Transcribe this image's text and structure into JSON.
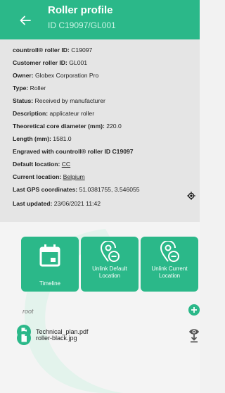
{
  "header": {
    "title": "Roller profile",
    "subtitle": "ID C19097/GL001"
  },
  "details": [
    {
      "label": "countroll® roller ID:",
      "value": "C19097"
    },
    {
      "label": "Customer roller ID:",
      "value": "GL001"
    },
    {
      "label": "Owner:",
      "value": "Globex Corporation Pro"
    },
    {
      "label": "Type:",
      "value": "Roller"
    },
    {
      "label": "Status:",
      "value": "Received by manufacturer"
    },
    {
      "label": "Description:",
      "value": "applicateur roller"
    },
    {
      "label": "Theoretical core diameter (mm):",
      "value": "220.0"
    },
    {
      "label": "Length (mm):",
      "value": "1581.0"
    },
    {
      "label": "Engraved with countroll® roller ID C19097",
      "value": ""
    },
    {
      "label": "Default location:",
      "value": "CC"
    },
    {
      "label": "Current location:",
      "value": "Belgium"
    },
    {
      "label": "Last GPS coordinates:",
      "value": "51.0381755, 3.546055"
    },
    {
      "label": "Last updated:",
      "value": "23/06/2021 11:42"
    }
  ],
  "actions": [
    {
      "label": "Timeline",
      "icon": "calendar-icon"
    },
    {
      "label": "Unlink Default Location",
      "icon": "location-unlink-icon"
    },
    {
      "label": "Unlink Current Location",
      "icon": "location-unlink-icon"
    }
  ],
  "files": {
    "root_label": "root",
    "items": [
      {
        "name": "Technical_plan.pdf",
        "icon": "file-icon",
        "action_icon": "eye-icon"
      },
      {
        "name": "roller-black.jpg",
        "icon": "file-icon",
        "action_icon": "download-icon"
      }
    ]
  },
  "colors": {
    "accent": "#2bb889",
    "details_background": "#e5e5e5",
    "page_background": "#f3f3f3"
  }
}
